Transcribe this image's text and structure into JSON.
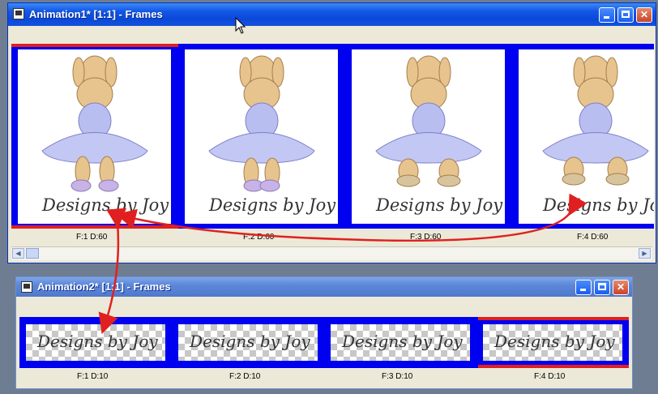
{
  "window1": {
    "title": "Animation1* [1:1] - Frames",
    "frames": [
      {
        "caption": "F:1   D:60",
        "signature": "Designs by Joy",
        "selected": true
      },
      {
        "caption": "F:2   D:60",
        "signature": "Designs by Joy",
        "selected": false
      },
      {
        "caption": "F:3   D:60",
        "signature": "Designs by Joy",
        "selected": false
      },
      {
        "caption": "F:4   D:60",
        "signature": "Designs by Joy",
        "selected": false
      }
    ]
  },
  "window2": {
    "title": "Animation2* [1:1] - Frames",
    "frames": [
      {
        "caption": "F:1   D:10",
        "signature": "Designs by Joy",
        "selected": false
      },
      {
        "caption": "F:2   D:10",
        "signature": "Designs by Joy",
        "selected": false
      },
      {
        "caption": "F:3   D:10",
        "signature": "Designs by Joy",
        "selected": false
      },
      {
        "caption": "F:4   D:10",
        "signature": "Designs by Joy",
        "selected": true
      }
    ]
  },
  "colors": {
    "frame_strip": "#0000f0",
    "selection": "#e02020",
    "arrows": "#e02020"
  },
  "icons": [
    "app-icon",
    "minimize-icon",
    "maximize-icon",
    "close-icon",
    "cursor-icon"
  ]
}
